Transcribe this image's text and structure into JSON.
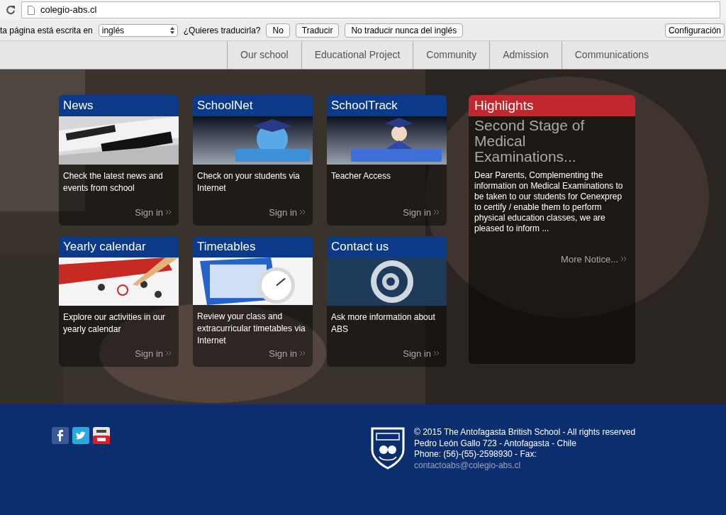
{
  "browser": {
    "url": "colegio-abs.cl"
  },
  "translate_bar": {
    "prefix": "ta página está escrita en",
    "language": "inglés",
    "question": "¿Quieres traducirla?",
    "buttons": [
      "No",
      "Traducir",
      "No traducir nunca del inglés"
    ],
    "settings": "Configuración"
  },
  "nav": [
    {
      "label": "Our school"
    },
    {
      "label": "Educational Project"
    },
    {
      "label": "Community"
    },
    {
      "label": "Admission"
    },
    {
      "label": "Communications"
    }
  ],
  "cards": [
    {
      "title": "News",
      "kind": "news",
      "text": "Check the latest news and events from school",
      "link": "Sign in"
    },
    {
      "title": "SchoolNet",
      "kind": "globe",
      "text": "Check on your students via Internet",
      "link": "Sign in"
    },
    {
      "title": "SchoolTrack",
      "kind": "graduate",
      "text": "Teacher Access",
      "link": "Sign in"
    },
    {
      "title": "Yearly calendar",
      "kind": "calendar",
      "text": "Explore our activities in our yearly calendar",
      "link": "Sign in"
    },
    {
      "title": "Timetables",
      "kind": "clock",
      "text": "Review your class and extracurricular timetables via Internet",
      "link": "Sign in"
    },
    {
      "title": "Contact us",
      "kind": "at",
      "text": "Ask more information about ABS",
      "link": "Sign in"
    }
  ],
  "highlights": {
    "title": "Highlights",
    "headline": "Second Stage of Medical Examinations...",
    "body": "Dear Parents, Complementing the information on Medical Examinations to be taken to our students for Cenexprep to certify / enable them to perform physical education classes, we are pleased to inform ...",
    "link": "More Notice..."
  },
  "footer": {
    "lines": [
      "© 2015 The Antofagasta British School - All rights reserved",
      "Pedro León Gallo 723 - Antofagasta - Chile",
      "Phone: (56)-(55)-2598930 - Fax:"
    ],
    "email": "contactoabs@colegio-abs.cl"
  }
}
